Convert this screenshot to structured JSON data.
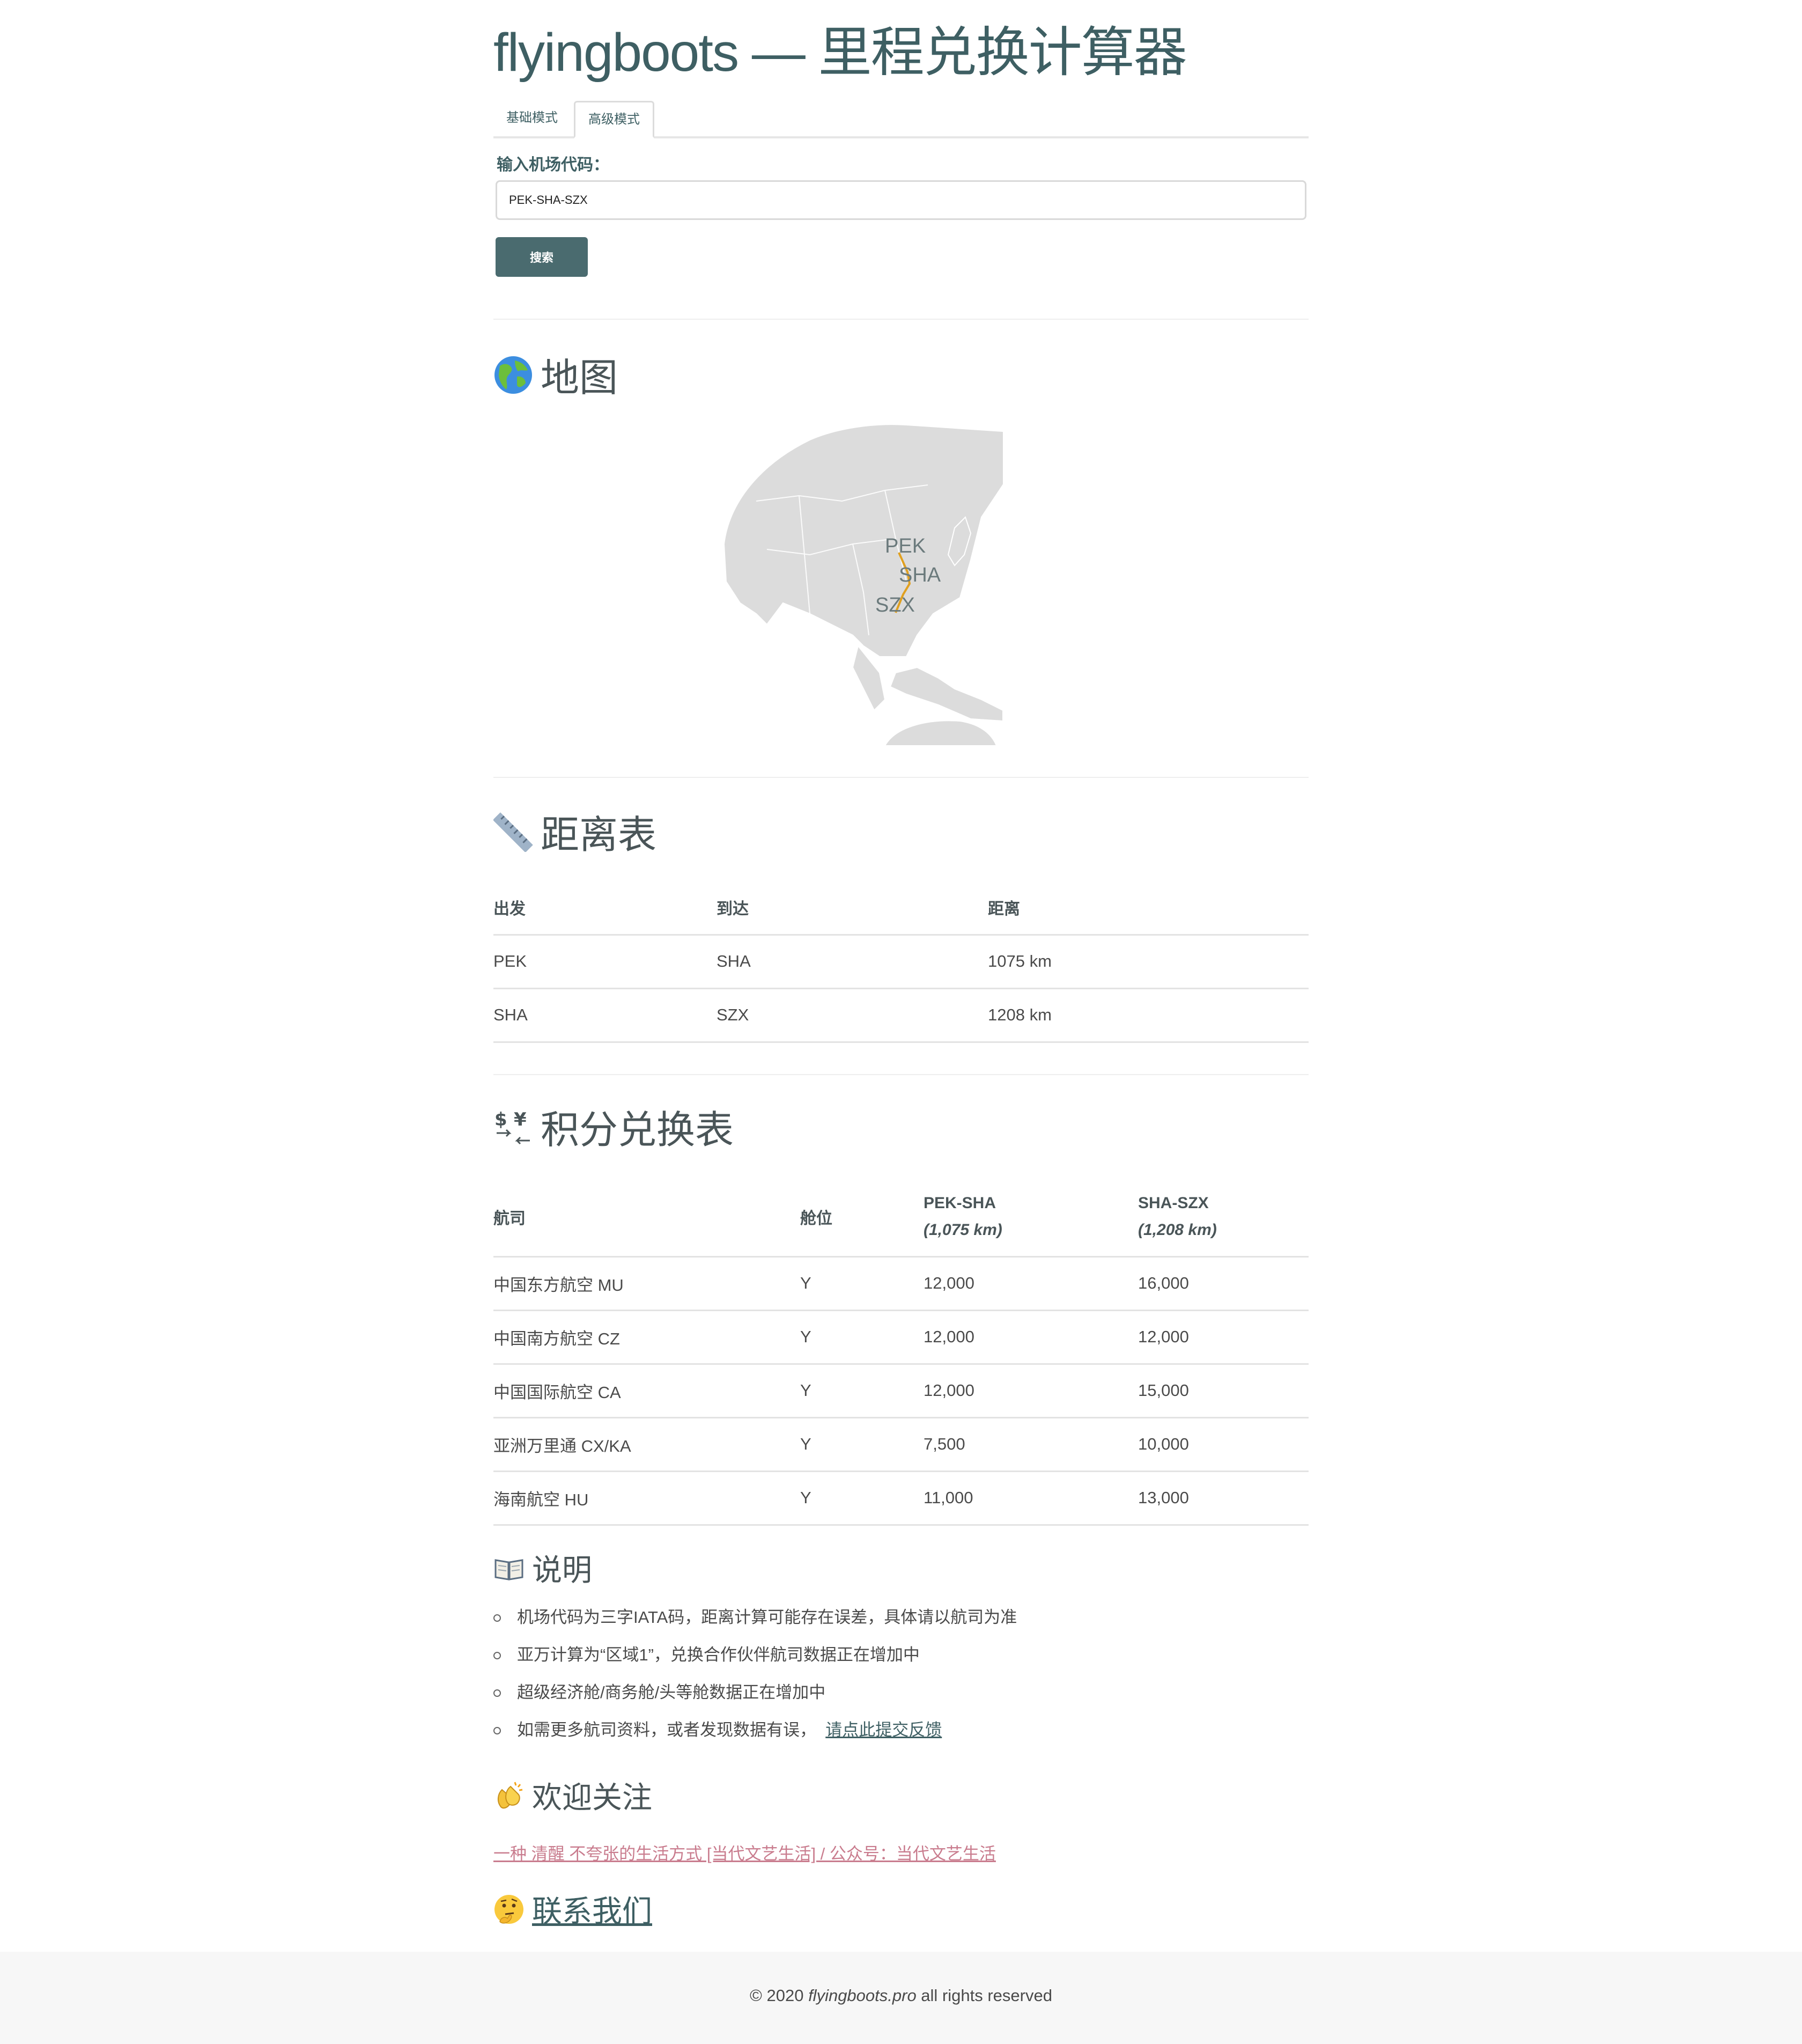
{
  "header": {
    "title": "flyingboots — 里程兑换计算器"
  },
  "tabs": [
    {
      "label": "基础模式"
    },
    {
      "label": "高级模式",
      "active": true
    }
  ],
  "search": {
    "label": "输入机场代码：",
    "value": "PEK-SHA-SZX",
    "button_label": "搜索"
  },
  "map_section": {
    "icon": "globe-icon",
    "title": "地图",
    "airports": [
      {
        "code": "PEK"
      },
      {
        "code": "SHA"
      },
      {
        "code": "SZX"
      }
    ],
    "route_color": "#e0a020",
    "land_color": "#dcdcdc"
  },
  "distance_section": {
    "icon": "ruler-icon",
    "title": "距离表",
    "headers": {
      "from": "出发",
      "to": "到达",
      "distance": "距离"
    },
    "rows": [
      {
        "from": "PEK",
        "to": "SHA",
        "distance": "1075 km"
      },
      {
        "from": "SHA",
        "to": "SZX",
        "distance": "1208 km"
      }
    ]
  },
  "points_section": {
    "icon": "currency-exchange-icon",
    "title": "积分兑换表",
    "headers": {
      "airline": "航司",
      "cabin": "舱位",
      "seg1": "PEK-SHA",
      "seg1_dist": "(1,075 km)",
      "seg2": "SHA-SZX",
      "seg2_dist": "(1,208 km)"
    },
    "rows": [
      {
        "airline": "中国东方航空 MU",
        "cabin": "Y",
        "seg1": "12,000",
        "seg2": "16,000"
      },
      {
        "airline": "中国南方航空 CZ",
        "cabin": "Y",
        "seg1": "12,000",
        "seg2": "12,000"
      },
      {
        "airline": "中国国际航空 CA",
        "cabin": "Y",
        "seg1": "12,000",
        "seg2": "15,000"
      },
      {
        "airline": "亚洲万里通 CX/KA",
        "cabin": "Y",
        "seg1": "7,500",
        "seg2": "10,000"
      },
      {
        "airline": "海南航空 HU",
        "cabin": "Y",
        "seg1": "11,000",
        "seg2": "13,000"
      }
    ]
  },
  "notes_section": {
    "icon": "open-book-icon",
    "title": "说明",
    "items": [
      "机场代码为三字IATA码，距离计算可能存在误差，具体请以航司为准",
      "亚万计算为“区域1”，兑换合作伙伴航司数据正在增加中",
      "超级经济舱/商务舱/头等舱数据正在增加中",
      "如需更多航司资料，或者发现数据有误，"
    ],
    "feedback_link": "请点此提交反馈"
  },
  "follow_section": {
    "icon": "clapping-hands-icon",
    "title": "欢迎关注",
    "link": "一种 清醒 不夸张的生活方式 [当代文艺生活] / 公众号：当代文艺生活"
  },
  "contact_section": {
    "icon": "thinking-face-icon",
    "title": "联系我们"
  },
  "footer": {
    "prefix": "© 2020 ",
    "site": "flyingboots.pro",
    "suffix": " all rights reserved"
  }
}
